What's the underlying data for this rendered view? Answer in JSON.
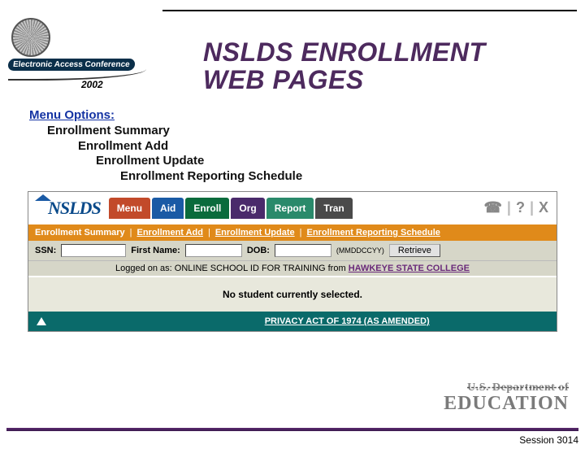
{
  "logo": {
    "conference": "Electronic Access Conference",
    "year": "2002"
  },
  "title_line1": "NSLDS ENROLLMENT",
  "title_line2": "WEB PAGES",
  "menu": {
    "header": "Menu Options:",
    "items": [
      "Enrollment Summary",
      "Enrollment Add",
      "Enrollment Update",
      "Enrollment Reporting Schedule"
    ]
  },
  "shot": {
    "brand": "NSLDS",
    "tabs": {
      "menu": "Menu",
      "aid": "Aid",
      "enroll": "Enroll",
      "org": "Org",
      "report": "Report",
      "tran": "Tran"
    },
    "util": {
      "phone": "☎",
      "help": "?",
      "close": "X"
    },
    "subtabs": {
      "active": "Enrollment Summary",
      "add": "Enrollment Add",
      "update": "Enrollment Update",
      "sched": "Enrollment Reporting Schedule"
    },
    "search": {
      "ssn_label": "SSN:",
      "first_label": "First Name:",
      "dob_label": "DOB:",
      "dob_hint": "(MMDDCCYY)",
      "retrieve": "Retrieve"
    },
    "logged_prefix": "Logged on as: ONLINE SCHOOL ID FOR TRAINING from ",
    "logged_school": "HAWKEYE STATE COLLEGE",
    "no_student": "No student currently selected.",
    "privacy": "PRIVACY ACT OF 1974 (AS AMENDED)"
  },
  "footer": {
    "dept": "U.S. Department of",
    "edu": "EDUCATION",
    "session": "Session 3014"
  }
}
